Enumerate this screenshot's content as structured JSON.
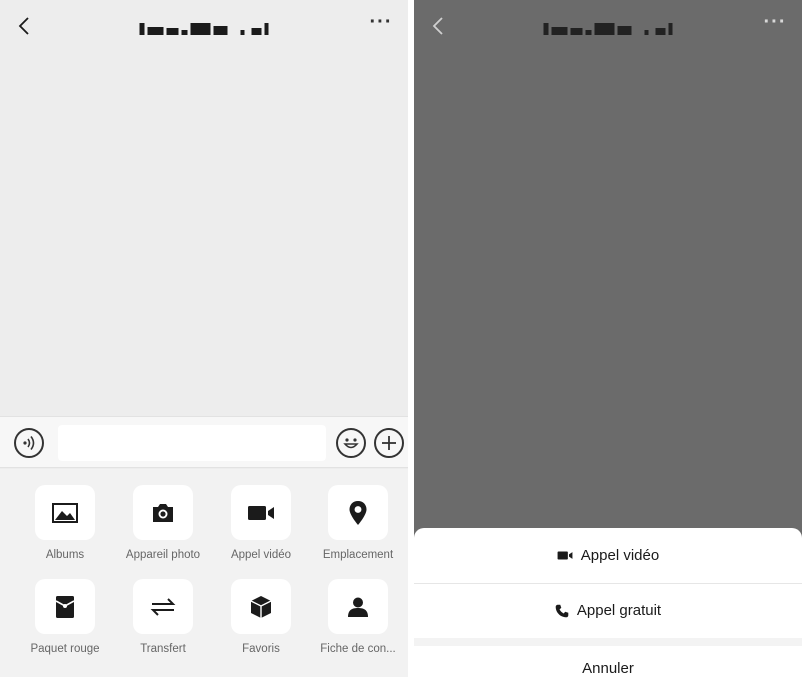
{
  "left_screen": {
    "nav": {
      "back_glyph": "‹",
      "more_glyph": "···"
    },
    "input_bar": {
      "placeholder": ""
    },
    "tools": [
      {
        "label": "Albums",
        "icon": "image-icon"
      },
      {
        "label": "Appareil photo",
        "icon": "camera-icon"
      },
      {
        "label": "Appel vidéo",
        "icon": "video-camera-icon"
      },
      {
        "label": "Emplacement",
        "icon": "location-pin-icon"
      },
      {
        "label": "Paquet rouge",
        "icon": "red-packet-icon"
      },
      {
        "label": "Transfert",
        "icon": "transfer-arrows-icon"
      },
      {
        "label": "Favoris",
        "icon": "cube-icon"
      },
      {
        "label": "Fiche de con...",
        "icon": "contact-card-icon"
      }
    ]
  },
  "right_screen": {
    "nav": {
      "back_glyph": "‹",
      "more_glyph": "···"
    },
    "sheet": {
      "video_call": "Appel vidéo",
      "voice_call": "Appel gratuit",
      "cancel": "Annuler"
    }
  },
  "colors": {
    "chat_background": "#ededed",
    "overlay": "#6b6b6b",
    "icon_dark": "#1b1b1b"
  }
}
